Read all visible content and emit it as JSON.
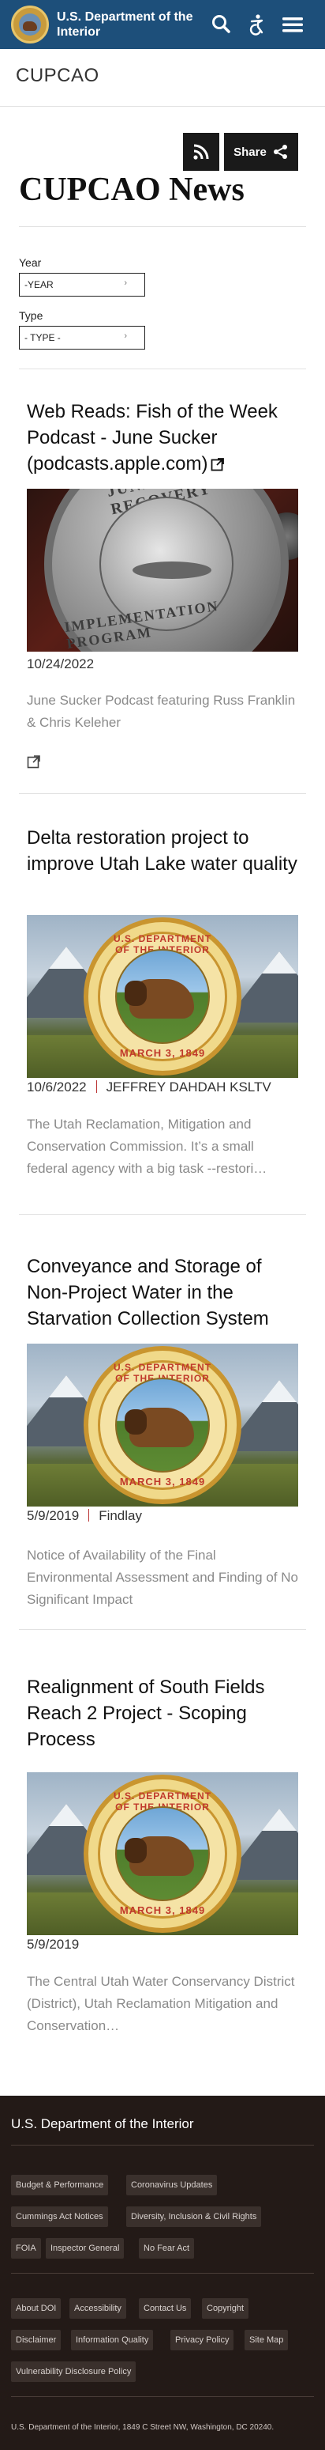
{
  "header": {
    "agency": "U.S. Department of the Interior",
    "search_icon": "search-icon",
    "accessibility_icon": "accessibility-icon",
    "menu_icon": "hamburger-menu-icon"
  },
  "site": {
    "name": "CUPCAO"
  },
  "toolbar": {
    "share_label": "Share",
    "rss_icon": "rss-icon",
    "share_icon": "share-icon"
  },
  "page": {
    "title": "CUPCAO News"
  },
  "filters": {
    "year_label": "Year",
    "year_value": "-YEAR",
    "type_label": "Type",
    "type_value": "- TYPE -",
    "chevron": "›"
  },
  "articles": [
    {
      "title": "Web Reads: Fish of the Week Podcast - June Sucker (podcasts.apple.com)",
      "date": "10/24/2022",
      "source": "",
      "description": "June Sucker Podcast featuring Russ Franklin & Chris Keleher",
      "coin_top": "JUNE SUCKER RECOVERY",
      "coin_bottom": "IMPLEMENTATION PROGRAM"
    },
    {
      "title": "Delta restoration project to improve Utah Lake water quality",
      "date": "10/6/2022",
      "source": "JEFFREY DAHDAH KSLTV",
      "description": "The Utah Reclamation, Mitigation and Conservation Commission. It’s a small federal agency with a big task --restori…",
      "seal_top": "U.S. DEPARTMENT OF THE INTERIOR",
      "seal_bottom": "MARCH 3, 1849"
    },
    {
      "title": "Conveyance and Storage of Non-Project Water in the Starvation Collection System",
      "date": "5/9/2019",
      "source": "Findlay",
      "description": "Notice of Availability of the Final Environmental Assessment and Finding of No Significant Impact",
      "seal_top": "U.S. DEPARTMENT OF THE INTERIOR",
      "seal_bottom": "MARCH 3, 1849"
    },
    {
      "title": "Realignment of South Fields Reach 2 Project - Scoping Process",
      "date": "5/9/2019",
      "source": "",
      "description": "The Central Utah Water Conservancy District (District), Utah Reclamation Mitigation and Conservation…",
      "seal_top": "U.S. DEPARTMENT OF THE INTERIOR",
      "seal_bottom": "MARCH 3, 1849"
    }
  ],
  "footer": {
    "title": "U.S. Department of the Interior",
    "links_primary": [
      "Budget & Performance",
      "Coronavirus Updates",
      "Cummings Act Notices",
      "Diversity, Inclusion & Civil Rights",
      "FOIA",
      "Inspector General",
      "No Fear Act"
    ],
    "links_secondary": [
      "About DOI",
      "Accessibility",
      "Contact Us",
      "Copyright",
      "Disclaimer",
      "Information Quality",
      "Privacy Policy",
      "Site Map",
      "Vulnerability Disclosure Policy"
    ],
    "address": "U.S. Department of the Interior, 1849 C Street NW, Washington, DC 20240."
  }
}
